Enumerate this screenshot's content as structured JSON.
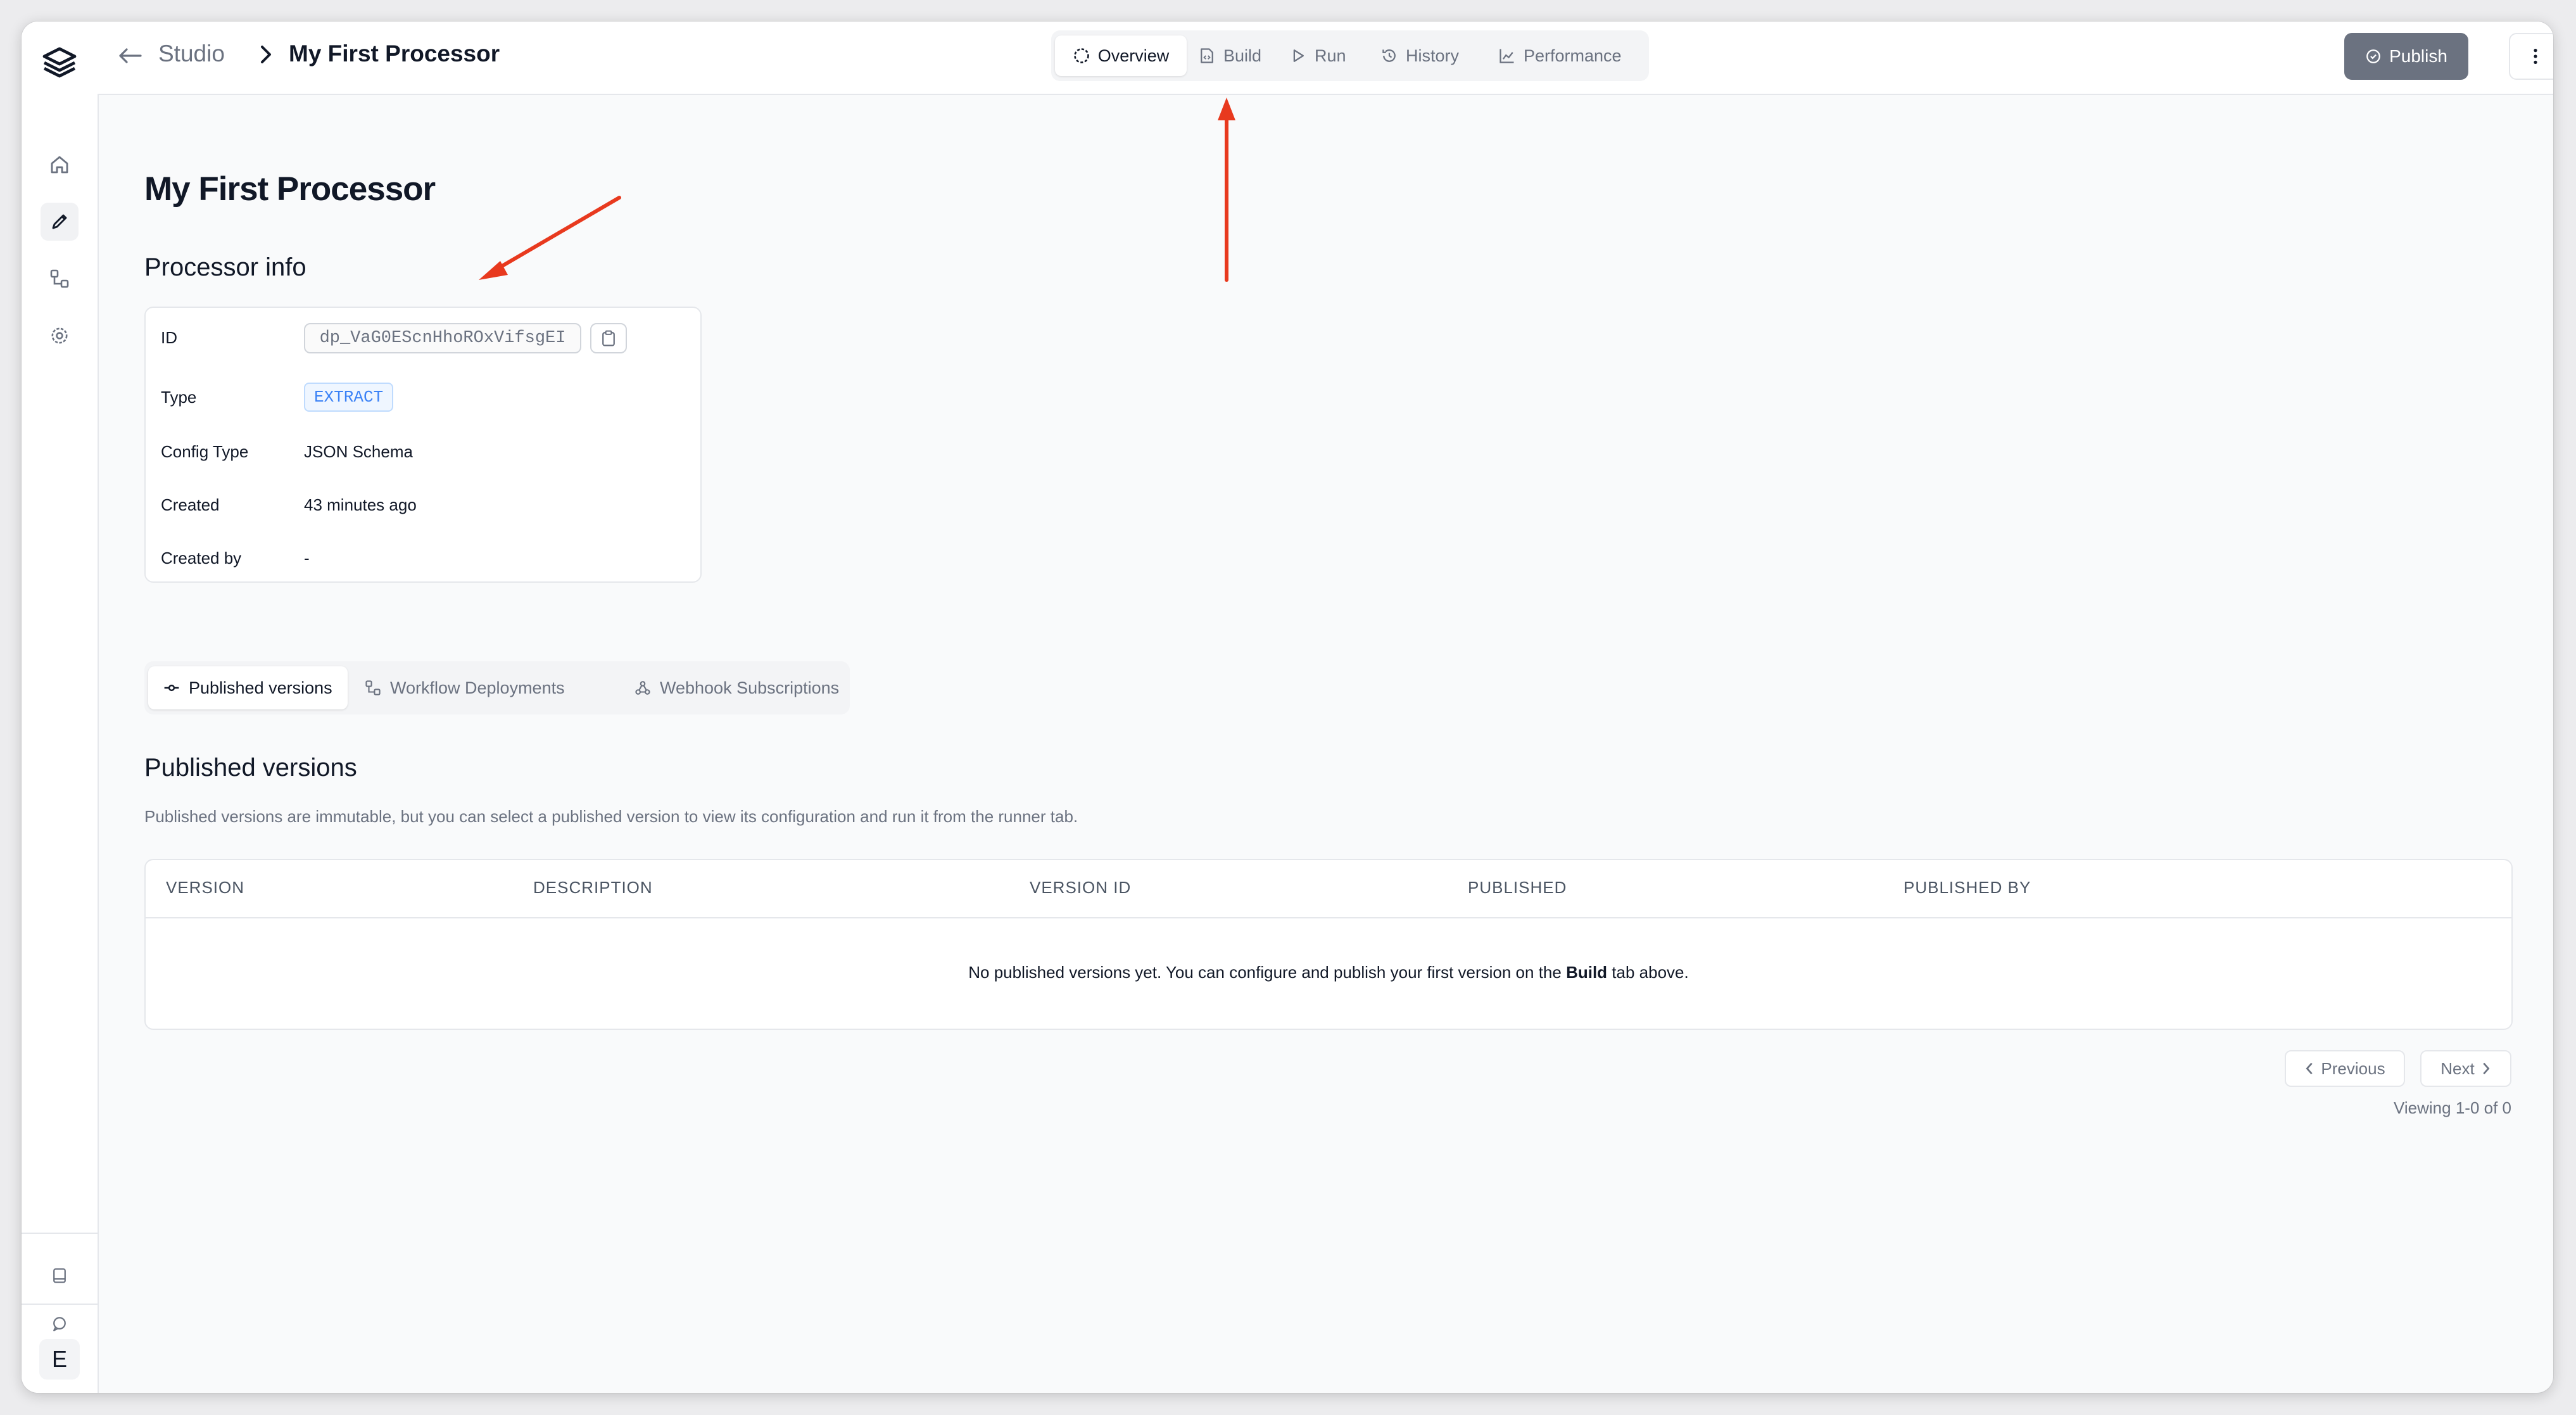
{
  "breadcrumb": {
    "studio": "Studio",
    "current": "My First Processor"
  },
  "top_tabs": [
    {
      "label": "Overview",
      "icon": "circle-dashed-icon",
      "active": true
    },
    {
      "label": "Build",
      "icon": "file-code-icon",
      "active": false
    },
    {
      "label": "Run",
      "icon": "play-icon",
      "active": false
    },
    {
      "label": "History",
      "icon": "history-icon",
      "active": false
    },
    {
      "label": "Performance",
      "icon": "chart-icon",
      "active": false
    }
  ],
  "actions": {
    "publish_label": "Publish"
  },
  "page": {
    "title": "My First Processor"
  },
  "processor_info": {
    "heading": "Processor info",
    "id_label": "ID",
    "id_value": "dp_VaG0EScnHhoROxVifsgEI",
    "type_label": "Type",
    "type_value": "EXTRACT",
    "config_type_label": "Config Type",
    "config_type_value": "JSON Schema",
    "created_label": "Created",
    "created_value": "43 minutes ago",
    "created_by_label": "Created by",
    "created_by_value": "-"
  },
  "sub_tabs": [
    {
      "label": "Published versions",
      "active": true
    },
    {
      "label": "Workflow Deployments",
      "active": false
    },
    {
      "label": "Webhook Subscriptions",
      "active": false
    }
  ],
  "published_versions": {
    "heading": "Published versions",
    "description": "Published versions are immutable, but you can select a published version to view its configuration and run it from the runner tab.",
    "columns": [
      "VERSION",
      "DESCRIPTION",
      "VERSION ID",
      "PUBLISHED",
      "PUBLISHED BY"
    ],
    "empty_prefix": "No published versions yet. You can configure and publish your first version on the ",
    "empty_bold": "Build",
    "empty_suffix": " tab above."
  },
  "pagination": {
    "previous": "Previous",
    "next": "Next",
    "viewing": "Viewing 1-0 of 0"
  },
  "sidebar": {
    "avatar_letter": "E"
  },
  "colors": {
    "annotation_arrow": "#e8391e",
    "publish_button": "#6b7280",
    "type_badge": "#3b82f6"
  }
}
